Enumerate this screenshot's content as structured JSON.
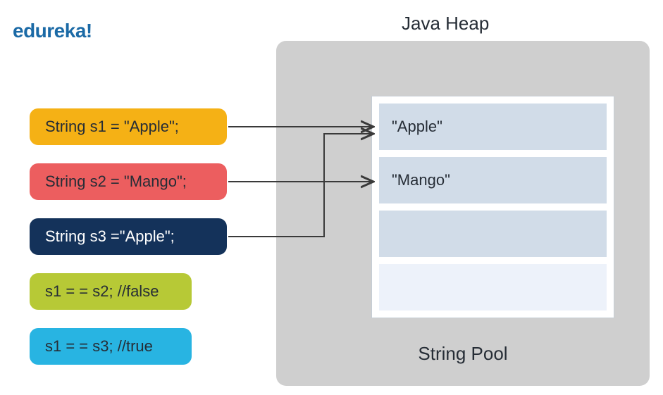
{
  "logo": "edureka!",
  "heap": {
    "title": "Java Heap",
    "pool_label": "String Pool",
    "rows": {
      "r0": "\"Apple\"",
      "r1": "\"Mango\"",
      "r2": "",
      "r3": ""
    }
  },
  "code": {
    "s1": "String s1 = \"Apple\";",
    "s2": "String s2 = \"Mango\";",
    "s3": "String s3 =\"Apple\";",
    "eq1": "s1 = = s2; //false",
    "eq2": "s1 = = s3; //true"
  },
  "colors": {
    "pill_s1": "#f5b115",
    "pill_s2": "#ec5e5f",
    "pill_s3": "#14325a",
    "pill_eq1": "#b7c936",
    "pill_eq2": "#28b4e2",
    "heap_bg": "#cfcfcf",
    "logo": "#1b6aa6"
  }
}
